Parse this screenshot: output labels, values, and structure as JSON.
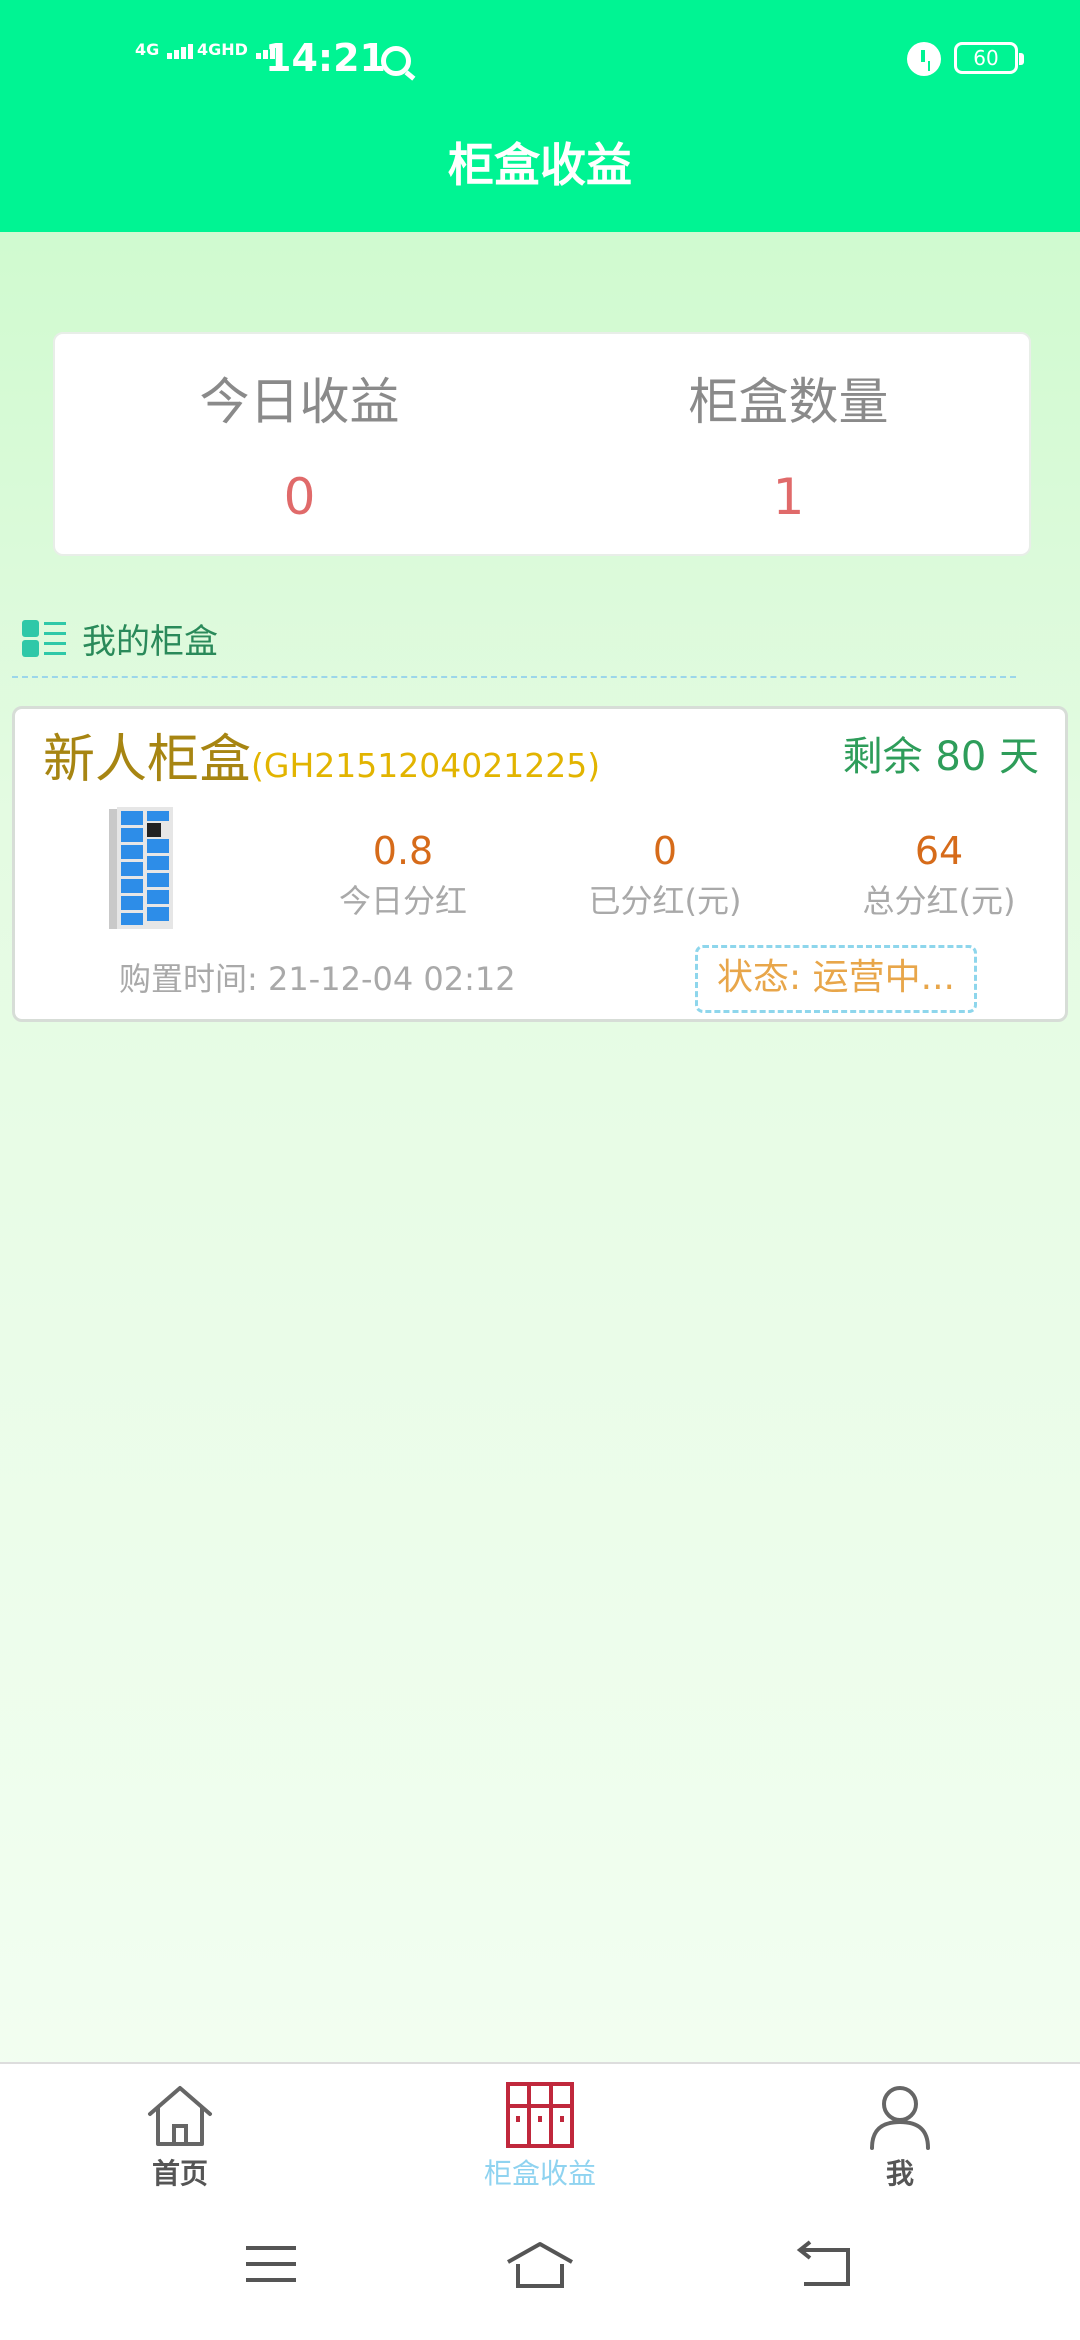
{
  "status_bar": {
    "network1": "4G",
    "network2": "4GHD",
    "time": "14:21",
    "battery": "60"
  },
  "header": {
    "title": "柜盒收益"
  },
  "summary": {
    "today_income_label": "今日收益",
    "today_income_value": "0",
    "box_count_label": "柜盒数量",
    "box_count_value": "1"
  },
  "section": {
    "title": "我的柜盒",
    "icon": "list-icon"
  },
  "boxes": [
    {
      "name": "新人柜盒",
      "code": "(GH2151204021225)",
      "remaining": "剩余 80 天",
      "icon": "locker-icon",
      "stats": [
        {
          "value": "0.8",
          "label": "今日分红"
        },
        {
          "value": "0",
          "label": "已分红(元)"
        },
        {
          "value": "64",
          "label": "总分红(元)"
        }
      ],
      "purchase_time": "购置时间: 21-12-04 02:12",
      "status": "状态: 运营中..."
    }
  ],
  "tabbar": {
    "items": [
      {
        "label": "首页",
        "icon": "home-icon",
        "active": false
      },
      {
        "label": "柜盒收益",
        "icon": "locker-grid-icon",
        "active": true
      },
      {
        "label": "我",
        "icon": "user-icon",
        "active": false
      }
    ]
  },
  "system_nav": {
    "menu": "menu-icon",
    "home": "home-nav-icon",
    "back": "back-icon"
  },
  "colors": {
    "header": "#00f493",
    "accent_red": "#e06a6a",
    "card_name": "#a78512",
    "code": "#e2b400",
    "remain": "#2e9d5a",
    "stat_value": "#d66b1a",
    "status": "#e8a64a",
    "active_tab": "#8fd3f0"
  }
}
